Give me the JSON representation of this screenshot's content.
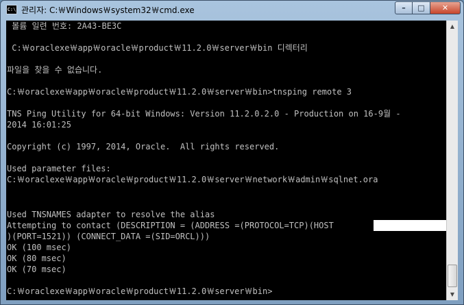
{
  "window": {
    "title": "관리자: C:￦Windows￦system32￦cmd.exe",
    "icon_label": "C:\\",
    "minimize_label": "–",
    "maximize_label": "□",
    "close_label": "✕"
  },
  "console": {
    "lines": [
      " 볼륨 일련 번호: 2A43-BE3C",
      "",
      " C:￦oraclexe￦app￦oracle￦product￦11.2.0￦server￦bin 디렉터리",
      "",
      "파일을 찾을 수 없습니다.",
      "",
      "C:￦oraclexe￦app￦oracle￦product￦11.2.0￦server￦bin>tnsping remote 3",
      "",
      "TNS Ping Utility for 64-bit Windows: Version 11.2.0.2.0 - Production on 16-9월 -",
      "2014 16:01:25",
      "",
      "Copyright (c) 1997, 2014, Oracle.  All rights reserved.",
      "",
      "Used parameter files:",
      "C:￦oraclexe￦app￦oracle￦product￦11.2.0￦server￦network￦admin￦sqlnet.ora",
      "",
      "",
      "Used TNSNAMES adapter to resolve the alias",
      "Attempting to contact (DESCRIPTION = (ADDRESS =(PROTOCOL=TCP)(HOST",
      ")(PORT=1521)) (CONNECT_DATA =(SID=ORCL)))",
      "OK (100 msec)",
      "OK (80 msec)",
      "OK (70 msec)",
      "",
      "C:￦oraclexe￦app￦oracle￦product￦11.2.0￦server￦bin>"
    ]
  },
  "scrollbar": {
    "up_arrow_icon": "triangle-up",
    "down_arrow_icon": "triangle-down"
  }
}
